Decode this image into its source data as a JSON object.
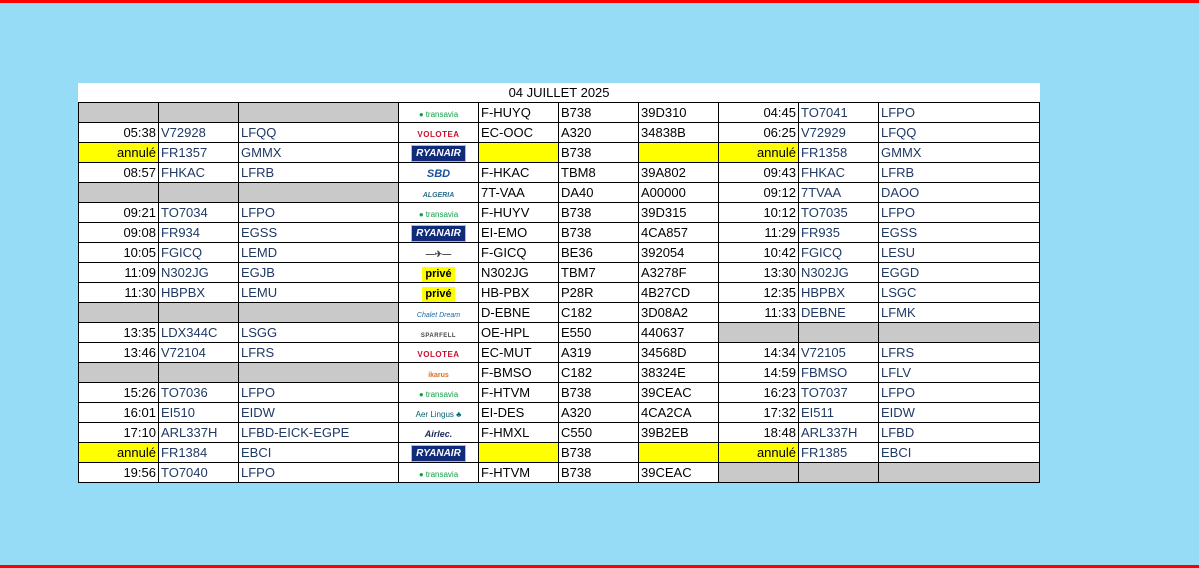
{
  "title": "04 JUILLET 2025",
  "rows": [
    {
      "arr_time": "",
      "arr_flight": "",
      "origin": "",
      "logo": "transavia",
      "logo_text": "transavia",
      "reg": "F-HUYQ",
      "type": "B738",
      "code": "39D310",
      "dep_time": "04:45",
      "dep_flight": "TO7041",
      "dest": "LFPO",
      "arr_grey": true
    },
    {
      "arr_time": "05:38",
      "arr_flight": "V72928",
      "origin": "LFQQ",
      "logo": "volotea",
      "logo_text": "VOLOTEA",
      "reg": "EC-OOC",
      "type": "A320",
      "code": "34838B",
      "dep_time": "06:25",
      "dep_flight": "V72929",
      "dest": "LFQQ"
    },
    {
      "arr_time": "annulé",
      "arr_flight": "FR1357",
      "origin": "GMMX",
      "logo": "ryanair",
      "logo_text": "RYANAIR",
      "reg": "",
      "type": "B738",
      "code": "",
      "dep_time": "annulé",
      "dep_flight": "FR1358",
      "dest": "GMMX",
      "cancelled": true
    },
    {
      "arr_time": "08:57",
      "arr_flight": "FHKAC",
      "origin": "LFRB",
      "logo": "sbd",
      "logo_text": "SBD",
      "reg": "F-HKAC",
      "type": "TBM8",
      "code": "39A802",
      "dep_time": "09:43",
      "dep_flight": "FHKAC",
      "dest": "LFRB"
    },
    {
      "arr_time": "",
      "arr_flight": "",
      "origin": "",
      "logo": "algeria",
      "logo_text": "ALGERIA",
      "reg": "7T-VAA",
      "type": "DA40",
      "code": "A00000",
      "dep_time": "09:12",
      "dep_flight": "7TVAA",
      "dest": "DAOO",
      "arr_grey": true
    },
    {
      "arr_time": "09:21",
      "arr_flight": "TO7034",
      "origin": "LFPO",
      "logo": "transavia",
      "logo_text": "transavia",
      "reg": "F-HUYV",
      "type": "B738",
      "code": "39D315",
      "dep_time": "10:12",
      "dep_flight": "TO7035",
      "dest": "LFPO"
    },
    {
      "arr_time": "09:08",
      "arr_flight": "FR934",
      "origin": "EGSS",
      "logo": "ryanair",
      "logo_text": "RYANAIR",
      "reg": "EI-EMO",
      "type": "B738",
      "code": "4CA857",
      "dep_time": "11:29",
      "dep_flight": "FR935",
      "dest": "EGSS"
    },
    {
      "arr_time": "10:05",
      "arr_flight": "FGICQ",
      "origin": "LEMD",
      "logo": "wings",
      "logo_text": "—✈—",
      "reg": "F-GICQ",
      "type": "BE36",
      "code": "392054",
      "dep_time": "10:42",
      "dep_flight": "FGICQ",
      "dest": "LESU"
    },
    {
      "arr_time": "11:09",
      "arr_flight": "N302JG",
      "origin": "EGJB",
      "logo": "prive",
      "logo_text": "privé",
      "reg": "N302JG",
      "type": "TBM7",
      "code": "A3278F",
      "dep_time": "13:30",
      "dep_flight": "N302JG",
      "dest": "EGGD"
    },
    {
      "arr_time": "11:30",
      "arr_flight": "HBPBX",
      "origin": "LEMU",
      "logo": "prive",
      "logo_text": "privé",
      "reg": "HB-PBX",
      "type": "P28R",
      "code": "4B27CD",
      "dep_time": "12:35",
      "dep_flight": "HBPBX",
      "dest": "LSGC"
    },
    {
      "arr_time": "",
      "arr_flight": "",
      "origin": "",
      "logo": "chalet",
      "logo_text": "Chalet Dream",
      "reg": "D-EBNE",
      "type": "C182",
      "code": "3D08A2",
      "dep_time": "11:33",
      "dep_flight": "DEBNE",
      "dest": "LFMK",
      "arr_grey": true
    },
    {
      "arr_time": "13:35",
      "arr_flight": "LDX344C",
      "origin": "LSGG",
      "logo": "sparfell",
      "logo_text": "SPARFELL",
      "reg": "OE-HPL",
      "type": "E550",
      "code": "440637",
      "dep_time": "",
      "dep_flight": "",
      "dest": "",
      "dep_grey": true
    },
    {
      "arr_time": "13:46",
      "arr_flight": "V72104",
      "origin": "LFRS",
      "logo": "volotea",
      "logo_text": "VOLOTEA",
      "reg": "EC-MUT",
      "type": "A319",
      "code": "34568D",
      "dep_time": "14:34",
      "dep_flight": "V72105",
      "dest": "LFRS"
    },
    {
      "arr_time": "",
      "arr_flight": "",
      "origin": "",
      "logo": "ikarus",
      "logo_text": "ikarus",
      "reg": "F-BMSO",
      "type": "C182",
      "code": "38324E",
      "dep_time": "14:59",
      "dep_flight": "FBMSO",
      "dest": "LFLV",
      "arr_grey": true
    },
    {
      "arr_time": "15:26",
      "arr_flight": "TO7036",
      "origin": "LFPO",
      "logo": "transavia",
      "logo_text": "transavia",
      "reg": "F-HTVM",
      "type": "B738",
      "code": "39CEAC",
      "dep_time": "16:23",
      "dep_flight": "TO7037",
      "dest": "LFPO"
    },
    {
      "arr_time": "16:01",
      "arr_flight": "EI510",
      "origin": "EIDW",
      "logo": "aerlingus",
      "logo_text": "Aer Lingus ♣",
      "reg": "EI-DES",
      "type": "A320",
      "code": "4CA2CA",
      "dep_time": "17:32",
      "dep_flight": "EI511",
      "dest": "EIDW"
    },
    {
      "arr_time": "17:10",
      "arr_flight": "ARL337H",
      "origin": "LFBD-EICK-EGPE",
      "logo": "airlec",
      "logo_text": "Airlec.",
      "reg": "F-HMXL",
      "type": "C550",
      "code": "39B2EB",
      "dep_time": "18:48",
      "dep_flight": "ARL337H",
      "dest": "LFBD"
    },
    {
      "arr_time": "annulé",
      "arr_flight": "FR1384",
      "origin": "EBCI",
      "logo": "ryanair",
      "logo_text": "RYANAIR",
      "reg": "",
      "type": "B738",
      "code": "",
      "dep_time": "annulé",
      "dep_flight": "FR1385",
      "dest": "EBCI",
      "cancelled": true
    },
    {
      "arr_time": "19:56",
      "arr_flight": "TO7040",
      "origin": "LFPO",
      "logo": "transavia",
      "logo_text": "transavia",
      "reg": "F-HTVM",
      "type": "B738",
      "code": "39CEAC",
      "dep_time": "",
      "dep_flight": "",
      "dest": "",
      "dep_grey": true
    }
  ]
}
